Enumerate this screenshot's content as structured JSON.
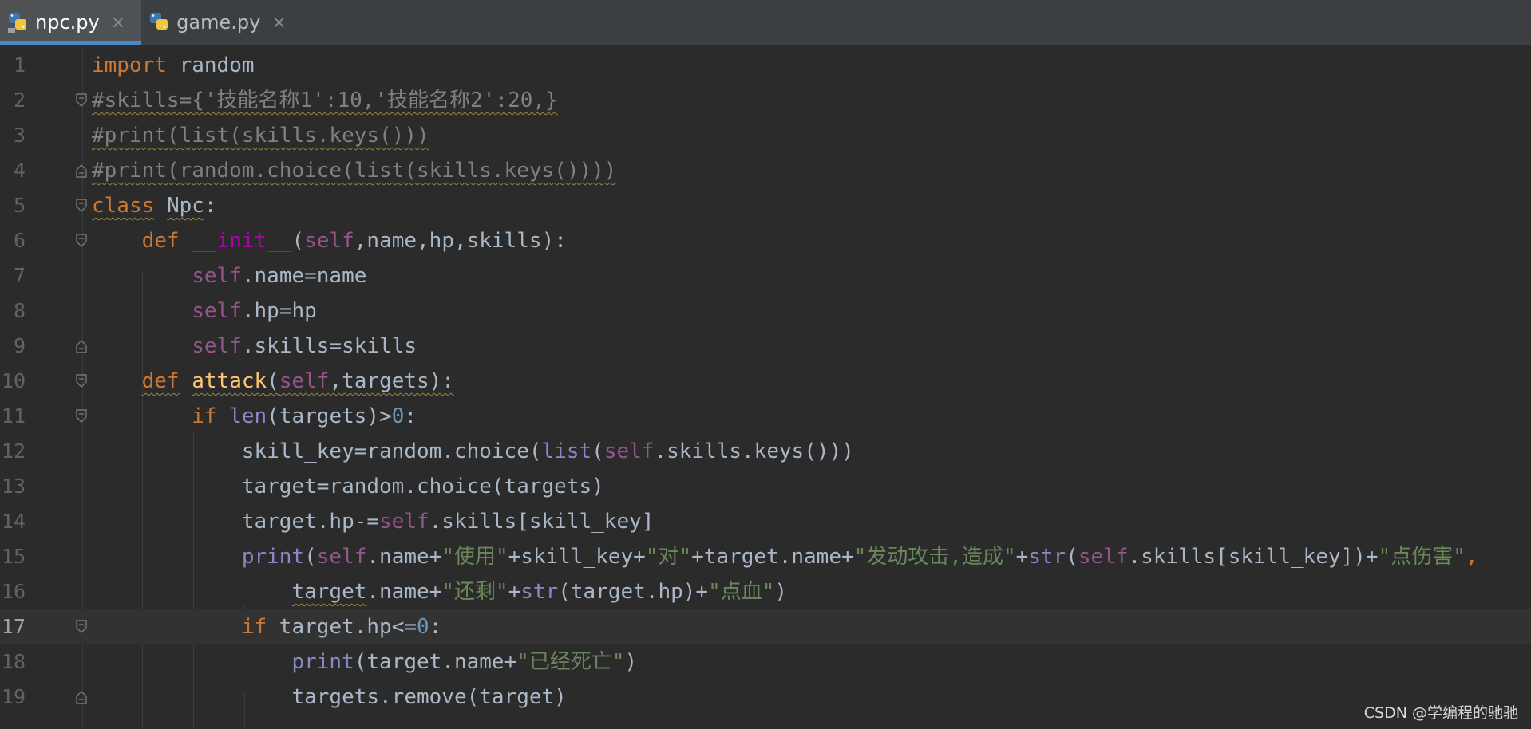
{
  "tabs": [
    {
      "label": "npc.py",
      "close": "×",
      "active": true
    },
    {
      "label": "game.py",
      "close": "×",
      "active": false
    }
  ],
  "gutter": [
    "1",
    "2",
    "3",
    "4",
    "5",
    "6",
    "7",
    "8",
    "9",
    "10",
    "11",
    "12",
    "13",
    "14",
    "15",
    "16",
    "17",
    "18",
    "19"
  ],
  "code_lines": [
    "import random",
    "#skills={'技能名称1':10,'技能名称2':20,}",
    "#print(list(skills.keys()))",
    "#print(random.choice(list(skills.keys())))",
    "class Npc:",
    "    def __init__(self,name,hp,skills):",
    "        self.name=name",
    "        self.hp=hp",
    "        self.skills=skills",
    "    def attack(self,targets):",
    "        if len(targets)>0:",
    "            skill_key=random.choice(list(self.skills.keys()))",
    "            target=random.choice(targets)",
    "            target.hp-=self.skills[skill_key]",
    "            print(self.name+\"使用\"+skill_key+\"对\"+target.name+\"发动攻击,造成\"+str(self.skills[skill_key])+\"点伤害\",",
    "                target.name+\"还剩\"+str(target.hp)+\"点血\")",
    "            if target.hp<=0:",
    "                print(target.name+\"已经死亡\")",
    "                targets.remove(target)"
  ],
  "current_line": "17",
  "watermark": "CSDN @学编程的驰驰",
  "colors": {
    "background": "#2b2b2b",
    "keyword": "#cc7832",
    "comment": "#808080",
    "self": "#94558d",
    "string": "#6a8759",
    "number": "#6897bb",
    "function": "#ffc66d"
  },
  "icons": {
    "tab_icon": "python-file-icon",
    "tab_close": "close-icon",
    "fold": "fold-marker-icon"
  }
}
